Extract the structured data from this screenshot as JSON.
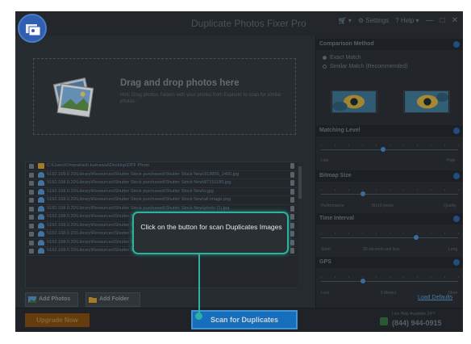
{
  "app": {
    "title": "Duplicate Photos Fixer Pro"
  },
  "menu": {
    "cart": "🛒 ▾",
    "settings": "⚙ Settings",
    "help": "? Help ▾",
    "minimize": "—",
    "maximize": "□",
    "close": "✕"
  },
  "dropzone": {
    "title": "Drag and drop photos here",
    "subtitle": "Hint: Drag photos, folders with your photos from Explorer to scan for similar photos"
  },
  "files": [
    {
      "type": "folder",
      "path": "C:\\Users\\Omprakash.kumawat\\Desktop\\DPF Photo"
    },
    {
      "type": "image",
      "path": "\\\\192.168.0.20\\Library\\Resources\\Shutter Stock purchased\\Shutter Stock New\\319856_1400.jpg"
    },
    {
      "type": "image",
      "path": "\\\\192.168.0.20\\Library\\Resources\\Shutter Stock purchased\\Shutter Stock New\\87151180.jpg"
    },
    {
      "type": "image",
      "path": "\\\\192.168.0.20\\Library\\Resources\\Shutter Stock purchased\\Shutter Stock New\\s.jpg"
    },
    {
      "type": "image",
      "path": "\\\\192.168.0.20\\Library\\Resources\\Shutter Stock purchased\\Shutter Stock New\\all image.png"
    },
    {
      "type": "image",
      "path": "\\\\192.168.0.20\\Library\\Resources\\Shutter Stock purchased\\Shutter Stock New\\photo (1).jpg"
    },
    {
      "type": "image",
      "path": "\\\\192.168.0.20\\Library\\Resources\\Shutter Stock purchased\\Shutter Stock New\\photo (2).jpg"
    },
    {
      "type": "image",
      "path": "\\\\192.168.0.20\\Library\\Resources\\Shutter Stock purchased\\Shutter Stock New\\photo (3).jpg"
    },
    {
      "type": "image",
      "path": "\\\\192.168.0.20\\Library\\Resources\\Shutter Stock purchased\\Shutter Stock New\\photo (4).jpg"
    },
    {
      "type": "image",
      "path": "\\\\192.168.0.20\\Library\\Resources\\Shutter Stock purchased\\Shutter Stock New\\photo (5).jpg"
    },
    {
      "type": "image",
      "path": "\\\\192.168.0.20\\Library\\Resources\\Shutter Stock purchased\\Shutter Stock New\\shutterstock_9324500.jpg"
    }
  ],
  "buttons": {
    "add_photos": "Add Photos",
    "add_folder": "Add Folder",
    "upgrade": "Upgrade Now",
    "scan": "Scan for Duplicates"
  },
  "comparison": {
    "heading": "Comparison Method",
    "exact": "Exact Match",
    "similar": "Similar Match (Recommended)",
    "selected": "exact"
  },
  "matching_level": {
    "heading": "Matching Level",
    "low": "Low",
    "high": "High",
    "value": 0.45
  },
  "bitmap_size": {
    "heading": "Bitmap Size",
    "left": "Performance",
    "mid": "16x16 pixels",
    "right": "Quality",
    "value": 0.3
  },
  "time_interval": {
    "heading": "Time Interval",
    "left": "Short",
    "mid": "30 seconds and less",
    "right": "Long",
    "value": 0.7
  },
  "gps": {
    "heading": "GPS",
    "left": "Less",
    "mid": "5 Meters",
    "right": "More",
    "value": 0.3
  },
  "load_defaults": "Load Defaults",
  "help": {
    "label": "Live Help Available 24*7",
    "phone": "(844) 944-0915"
  },
  "tooltip": {
    "text": "Click on the button for scan Duplicates Images"
  }
}
